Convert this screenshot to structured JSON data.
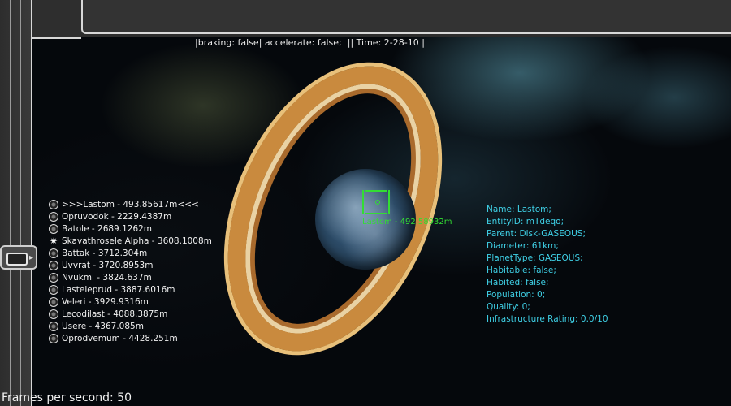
{
  "hud": {
    "status": "|braking: false| accelerate: false;  || Time: 2-28-10 |",
    "fps": "Frames per second: 50"
  },
  "target": {
    "label": "Lastom - 492.58932m",
    "reticle_color": "#33dd33"
  },
  "objects": [
    {
      "icon": "planet-icon",
      "text": ">>>Lastom - 493.85617m<<<"
    },
    {
      "icon": "planet-icon",
      "text": "Opruvodok - 2229.4387m"
    },
    {
      "icon": "planet-icon",
      "text": "Batole - 2689.1262m"
    },
    {
      "icon": "star-icon",
      "text": "Skavathrosele Alpha - 3608.1008m"
    },
    {
      "icon": "planet-icon",
      "text": "Battak - 3712.304m"
    },
    {
      "icon": "planet-icon",
      "text": "Uvvrat - 3720.8953m"
    },
    {
      "icon": "planet-icon",
      "text": "Nvukmi - 3824.637m"
    },
    {
      "icon": "planet-icon",
      "text": "Lasteleprud - 3887.6016m"
    },
    {
      "icon": "planet-icon",
      "text": "Veleri - 3929.9316m"
    },
    {
      "icon": "planet-icon",
      "text": "Lecodilast - 4088.3875m"
    },
    {
      "icon": "planet-icon",
      "text": "Usere - 4367.085m"
    },
    {
      "icon": "planet-icon",
      "text": "Oprodvemum - 4428.251m"
    }
  ],
  "info": [
    "Name: Lastom;",
    "EntityID: mTdeqo;",
    "Parent: Disk-GASEOUS;",
    "Diameter: 61km;",
    "PlanetType: GASEOUS;",
    "Habitable: false;",
    "Habited: false;",
    "Population: 0;",
    "Quality: 0;",
    "Infrastructure Rating: 0.0/10"
  ],
  "colors": {
    "info_text": "#3fd0e6",
    "list_text": "#f0f0f0",
    "frame": "#2e2e2e",
    "ring": "#c98a3e"
  }
}
